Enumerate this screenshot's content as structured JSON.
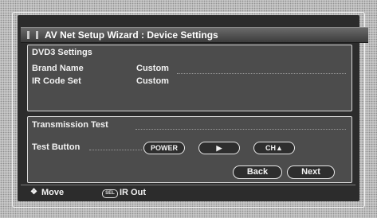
{
  "window": {
    "title": "AV Net Setup Wizard : Device Settings"
  },
  "device_settings": {
    "heading": "DVD3 Settings",
    "rows": [
      {
        "label": "Brand Name",
        "value": "Custom"
      },
      {
        "label": "IR Code Set",
        "value": "Custom"
      }
    ]
  },
  "transmission_test": {
    "heading": "Transmission Test",
    "test_button_label": "Test Button",
    "buttons": [
      "POWER",
      "▶",
      "CH▲"
    ]
  },
  "navigation": {
    "back_label": "Back",
    "next_label": "Next"
  },
  "status_bar": {
    "move_icon": "❖",
    "move_label": "Move",
    "sel_badge": "SEL",
    "ir_out_label": "IR Out"
  }
}
